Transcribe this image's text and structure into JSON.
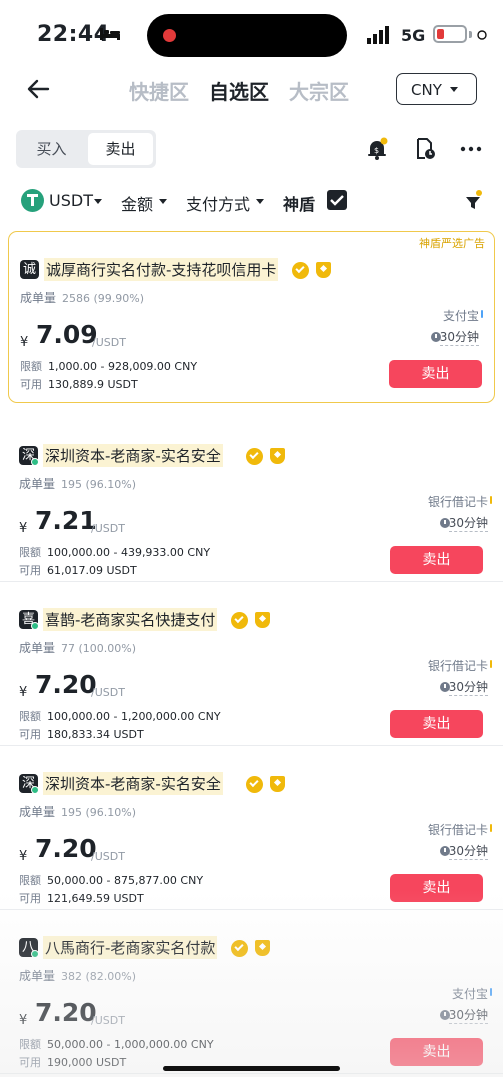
{
  "status_bar": {
    "time": "22:44",
    "network": "5G"
  },
  "header": {
    "tabs": [
      {
        "label": "快捷区",
        "active": false
      },
      {
        "label": "自选区",
        "active": true
      },
      {
        "label": "大宗区",
        "active": false
      }
    ],
    "currency": "CNY"
  },
  "toolbar": {
    "buy_label": "买入",
    "sell_label": "卖出",
    "selected": "卖出"
  },
  "filters": {
    "asset": "USDT",
    "amount_label": "金额",
    "payment_label": "支付方式",
    "shield_label": "神盾",
    "shield_checked": true
  },
  "ads": [
    {
      "promo_tag": "神盾严选广告",
      "avatar_char": "诚",
      "name": "诚厚商行实名付款-支持花呗信用卡",
      "stats_label": "成单量",
      "stats_value": "2586 (99.90%)",
      "currency_symbol": "¥",
      "price": "7.09",
      "unit": "/USDT",
      "payment": "支付宝",
      "payment_color": "#4fa3f7",
      "time_limit": "30分钟",
      "limit_label": "限额",
      "limit_value": "1,000.00 - 928,009.00 CNY",
      "avail_label": "可用",
      "avail_value": "130,889.9 USDT",
      "action": "卖出"
    },
    {
      "avatar_char": "深",
      "name": "深圳资本-老商家-实名安全",
      "stats_label": "成单量",
      "stats_value": "195 (96.10%)",
      "currency_symbol": "¥",
      "price": "7.21",
      "unit": "/USDT",
      "payment": "银行借记卡",
      "payment_color": "#f0b90b",
      "time_limit": "30分钟",
      "limit_label": "限额",
      "limit_value": "100,000.00 - 439,933.00 CNY",
      "avail_label": "可用",
      "avail_value": "61,017.09 USDT",
      "action": "卖出"
    },
    {
      "avatar_char": "喜",
      "name": "喜鹊-老商家实名快捷支付",
      "stats_label": "成单量",
      "stats_value": "77 (100.00%)",
      "currency_symbol": "¥",
      "price": "7.20",
      "unit": "/USDT",
      "payment": "银行借记卡",
      "payment_color": "#f0b90b",
      "time_limit": "30分钟",
      "limit_label": "限额",
      "limit_value": "100,000.00 - 1,200,000.00 CNY",
      "avail_label": "可用",
      "avail_value": "180,833.34 USDT",
      "action": "卖出"
    },
    {
      "avatar_char": "深",
      "name": "深圳资本-老商家-实名安全",
      "stats_label": "成单量",
      "stats_value": "195 (96.10%)",
      "currency_symbol": "¥",
      "price": "7.20",
      "unit": "/USDT",
      "payment": "银行借记卡",
      "payment_color": "#f0b90b",
      "time_limit": "30分钟",
      "limit_label": "限额",
      "limit_value": "50,000.00 - 875,877.00 CNY",
      "avail_label": "可用",
      "avail_value": "121,649.59 USDT",
      "action": "卖出"
    },
    {
      "avatar_char": "八",
      "name": "八馬商行-老商家实名付款",
      "stats_label": "成单量",
      "stats_value": "382 (82.00%)",
      "currency_symbol": "¥",
      "price": "7.20",
      "unit": "/USDT",
      "payment": "支付宝",
      "payment_color": "#4fa3f7",
      "time_limit": "30分钟",
      "limit_label": "限额",
      "limit_value": "50,000.00 - 1,000,000.00 CNY",
      "avail_label": "可用",
      "avail_value": "190,000 USDT",
      "action": "卖出"
    }
  ],
  "icons": [
    "back-arrow-icon",
    "bell-dollar-icon",
    "order-history-icon",
    "more-icon",
    "filter-funnel-icon",
    "usdt-logo-icon",
    "verified-badge-icon",
    "shield-badge-icon",
    "clock-icon"
  ],
  "colors": {
    "sell": "#f6465d",
    "accent": "#f0b90b",
    "online": "#2ebd85"
  }
}
